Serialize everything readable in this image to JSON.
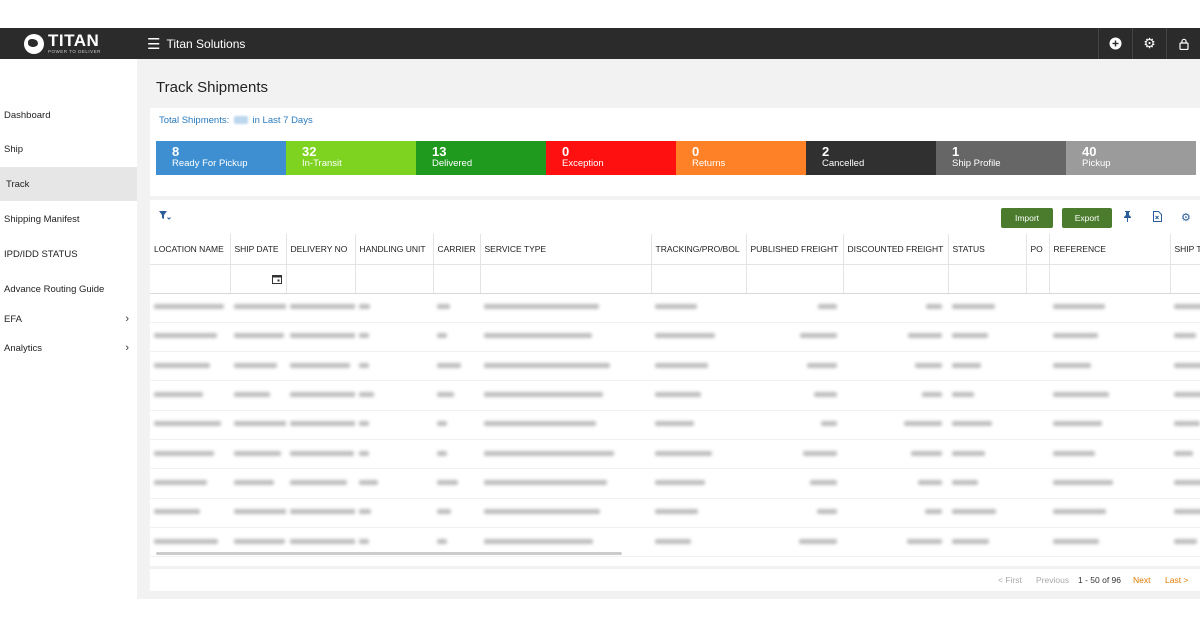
{
  "header": {
    "logo_name": "TITAN",
    "logo_tagline": "POWER TO DELIVER",
    "menu_icon": "hamburger-icon",
    "app_title": "Titan Solutions",
    "icons": [
      "add-circle-icon",
      "gear-icon",
      "lock-icon"
    ]
  },
  "sidebar": {
    "items": [
      {
        "label": "Dashboard"
      },
      {
        "label": "Ship"
      },
      {
        "label": "Track",
        "active": true
      },
      {
        "label": "Shipping Manifest"
      },
      {
        "label": "IPD/IDD STATUS"
      },
      {
        "label": "Advance Routing Guide"
      },
      {
        "label": "EFA",
        "has_submenu": true
      },
      {
        "label": "Analytics",
        "has_submenu": true
      }
    ],
    "chevron": "›"
  },
  "page": {
    "title": "Track Shipments",
    "total_prefix": "Total Shipments:",
    "total_suffix": "in Last 7 Days"
  },
  "tiles": [
    {
      "count": "8",
      "label": "Ready For Pickup",
      "color": "#3d8fd1"
    },
    {
      "count": "32",
      "label": "In-Transit",
      "color": "#7ed321"
    },
    {
      "count": "13",
      "label": "Delivered",
      "color": "#1f9a1f"
    },
    {
      "count": "0",
      "label": "Exception",
      "color": "#ff1010"
    },
    {
      "count": "0",
      "label": "Returns",
      "color": "#ff8127"
    },
    {
      "count": "2",
      "label": "Cancelled",
      "color": "#303030"
    },
    {
      "count": "1",
      "label": "Ship Profile",
      "color": "#666666"
    },
    {
      "count": "40",
      "label": "Pickup",
      "color": "#9b9b9b"
    }
  ],
  "toolbar": {
    "import_label": "Import",
    "export_label": "Export",
    "button_color": "#4b7b2d"
  },
  "grid": {
    "columns": [
      "LOCATION NAME",
      "SHIP DATE",
      "DELIVERY NO",
      "HANDLING UNIT",
      "CARRIER",
      "SERVICE TYPE",
      "TRACKING/PRO/BOL",
      "PUBLISHED FREIGHT",
      "DISCOUNTED FREIGHT",
      "STATUS",
      "PO",
      "REFERENCE",
      "SHIP T"
    ]
  },
  "pager": {
    "first": "< First",
    "previous": "Previous",
    "info": "1 - 50 of  96",
    "next": "Next",
    "last": "Last >"
  }
}
